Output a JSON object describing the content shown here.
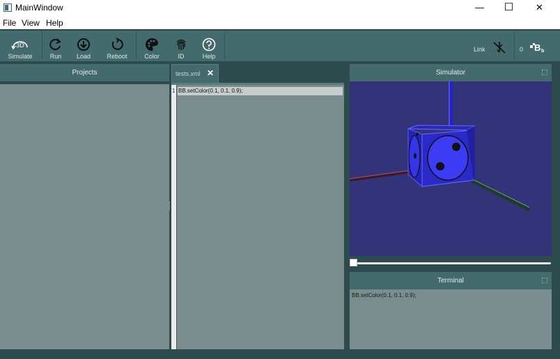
{
  "window": {
    "title": "MainWindow",
    "minimize_glyph": "—",
    "maximize_glyph": "☐",
    "close_glyph": "✕"
  },
  "menu": [
    "File",
    "View",
    "Help"
  ],
  "toolbar": {
    "simulate_badge": "3D",
    "simulate": "Simulate",
    "run": "Run",
    "load": "Load",
    "reboot": "Reboot",
    "color": "Color",
    "id": "ID",
    "help": "Help",
    "link": "Link",
    "count": "0"
  },
  "panels": {
    "projects": "Projects",
    "simulator": "Simulator",
    "terminal": "Terminal"
  },
  "editor": {
    "tab_name": "tests.xml",
    "tab_close": "✕",
    "line_number": "1",
    "code": "BB.setColor(0.1, 0.1, 0.9);"
  },
  "terminal": {
    "output": "BB.setColor(0.1, 0.1, 0.9);"
  },
  "simulator": {
    "slider_value": 0
  },
  "colors": {
    "toolbar_bg": "#436a6c",
    "panel_bg": "#7a8d8e",
    "sim_bg": "#333379",
    "cube_blue": "#3434f0"
  },
  "icons": {
    "simulate": "3d-cube-icon",
    "run": "refresh-icon",
    "load": "download-circle-icon",
    "reboot": "power-cycle-icon",
    "color": "palette-icon",
    "id": "fingerprint-icon",
    "help": "question-circle-icon",
    "link": "usb-disconnected-icon",
    "logo": "blinky-blocks-logo-icon"
  }
}
